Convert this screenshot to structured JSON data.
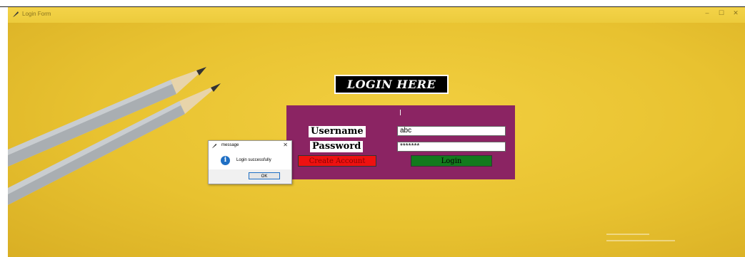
{
  "window": {
    "title": "Login Form",
    "controls": [
      "–",
      "☐",
      "✕"
    ]
  },
  "heading": "LOGIN HERE",
  "form": {
    "username_label": "Username",
    "password_label": "Password",
    "username_value": "abc",
    "password_value": "*******",
    "create_button": "Create Account",
    "login_button": "Login"
  },
  "dialog": {
    "title": "message",
    "text": "Login successfully",
    "ok_label": "OK",
    "close": "✕",
    "icon": "info-icon"
  },
  "colors": {
    "background": "#e9c53a",
    "panel": "#8b2463",
    "create_button": "#ee1111",
    "login_button": "#137a1d"
  }
}
